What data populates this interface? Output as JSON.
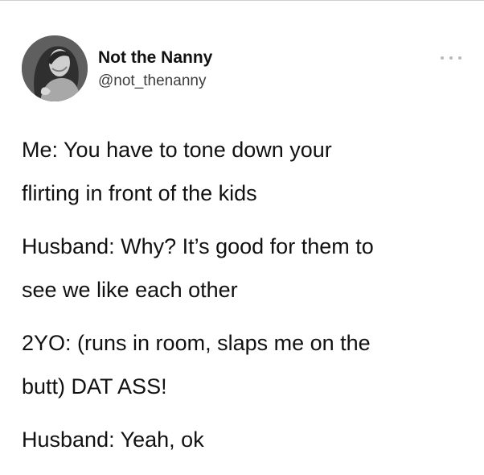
{
  "tweet": {
    "author": {
      "display_name": "Not the Nanny",
      "handle": "@not_thenanny",
      "avatar_icon": "profile-photo"
    },
    "more_icon": "more-dots-icon",
    "lines": [
      [
        "Me: You have to tone down your",
        "flirting in front of the kids"
      ],
      [
        "Husband: Why? It’s good for them to",
        "see we like each other"
      ],
      [
        "2YO: (runs in room, slaps me on the",
        "butt) DAT ASS!"
      ],
      [
        "Husband: Yeah, ok"
      ]
    ]
  },
  "colors": {
    "background": "#ffffff",
    "text": "#111111",
    "handle": "#3d3d3d",
    "more_dots": "#b9b9b9"
  }
}
